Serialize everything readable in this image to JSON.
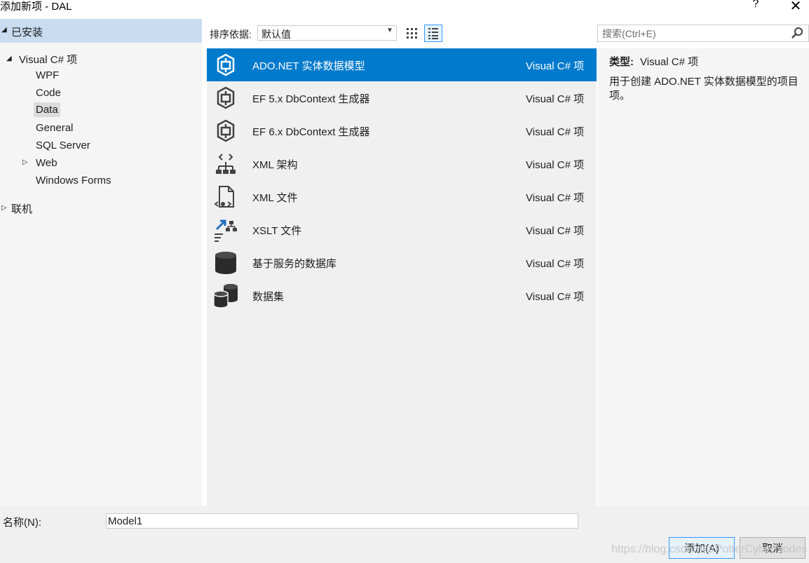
{
  "window": {
    "title": "添加新项 - DAL",
    "help_label": "?",
    "close_label": "✕"
  },
  "sidebar": {
    "installed_label": "已安装",
    "tree": {
      "visual_cs": "Visual C# 项",
      "wpf": "WPF",
      "code": "Code",
      "data": "Data",
      "general": "General",
      "sql_server": "SQL Server",
      "web": "Web",
      "windows_forms": "Windows Forms"
    },
    "online_label": "联机",
    "selected": "Data"
  },
  "toolbar": {
    "sort_label": "排序依据:",
    "sort_value": "默认值",
    "active_view": "list"
  },
  "items": [
    {
      "name": "ADO.NET 实体数据模型",
      "type": "Visual C# 项",
      "icon": "entity-model-icon"
    },
    {
      "name": "EF 5.x DbContext 生成器",
      "type": "Visual C# 项",
      "icon": "entity-model-icon"
    },
    {
      "name": "EF 6.x DbContext 生成器",
      "type": "Visual C# 项",
      "icon": "entity-model-icon"
    },
    {
      "name": "XML 架构",
      "type": "Visual C# 项",
      "icon": "xml-schema-icon"
    },
    {
      "name": "XML 文件",
      "type": "Visual C# 项",
      "icon": "xml-file-icon"
    },
    {
      "name": "XSLT 文件",
      "type": "Visual C# 项",
      "icon": "xslt-file-icon"
    },
    {
      "name": "基于服务的数据库",
      "type": "Visual C# 项",
      "icon": "database-icon"
    },
    {
      "name": "数据集",
      "type": "Visual C# 项",
      "icon": "dataset-icon"
    }
  ],
  "search": {
    "placeholder": "搜索(Ctrl+E)"
  },
  "details": {
    "type_label": "类型:",
    "type_value": "Visual C# 项",
    "description": "用于创建 ADO.NET 实体数据模型的项目项。"
  },
  "footer": {
    "name_label": "名称(N):",
    "name_value": "Model1",
    "add_label": "添加(A)",
    "cancel_label": "取消"
  },
  "watermark": "https://blog.csdn.net/PotterCyberNodes",
  "colors": {
    "accent": "#007acc",
    "selection_header": "#c9dcf0",
    "focus_border": "#3399ff"
  }
}
